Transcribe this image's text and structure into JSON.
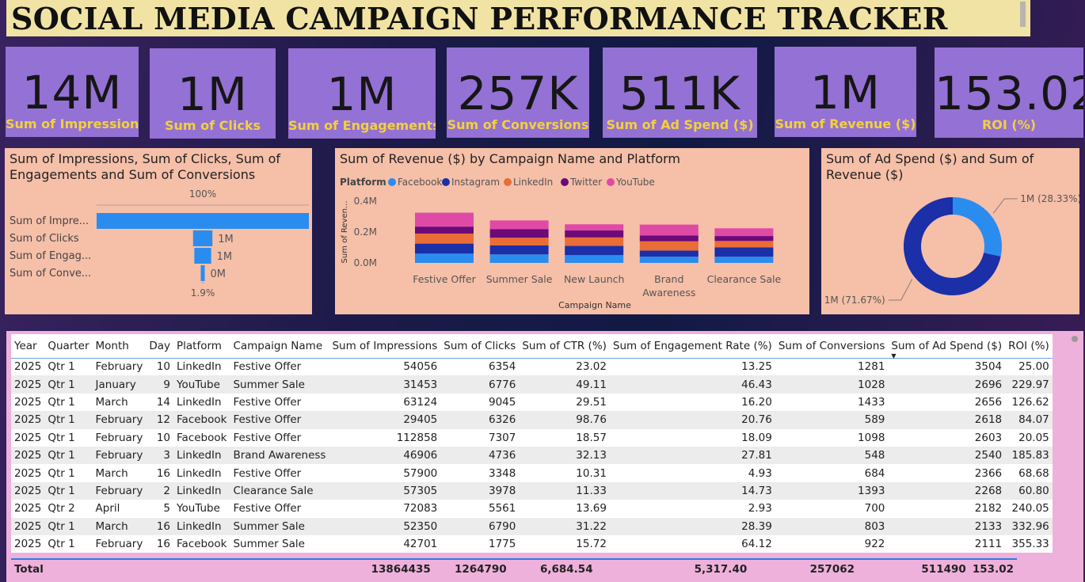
{
  "header": {
    "title": "SOCIAL MEDIA CAMPAIGN PERFORMANCE TRACKER"
  },
  "kpis": [
    {
      "value": "14M",
      "label": "Sum of Impressions"
    },
    {
      "value": "1M",
      "label": "Sum of Clicks"
    },
    {
      "value": "1M",
      "label": "Sum of Engagements"
    },
    {
      "value": "257K",
      "label": "Sum of Conversions"
    },
    {
      "value": "511K",
      "label": "Sum of Ad Spend ($)"
    },
    {
      "value": "1M",
      "label": "Sum of Revenue ($)"
    },
    {
      "value": "153.02",
      "label": "ROI (%)"
    }
  ],
  "colors": {
    "facebook": "#2b8cf0",
    "instagram": "#1a2fa8",
    "linkedin": "#ea6c37",
    "twitter": "#6b0a78",
    "youtube": "#df4aa6",
    "kpi_bg": "#9471d4",
    "kpi_label": "#f3d13a",
    "panel_bg": "#f6bfa8",
    "table_bg": "#eeb1db"
  },
  "funnel": {
    "title": "Sum of Impressions, Sum of Clicks, Sum of Engagements and Sum of Conversions",
    "top_label": "100%",
    "bottom_label": "1.9%",
    "items": [
      {
        "label": "Sum of Impre...",
        "value": 13864435,
        "value_label": ""
      },
      {
        "label": "Sum of Clicks",
        "value": 1264790,
        "value_label": "1M"
      },
      {
        "label": "Sum of Engag...",
        "value": 1100000,
        "value_label": "1M"
      },
      {
        "label": "Sum of Conve...",
        "value": 257062,
        "value_label": "0M"
      }
    ]
  },
  "revenue_chart": {
    "title": "Sum of Revenue ($) by Campaign Name and Platform",
    "legend_title": "Platform",
    "xlabel": "Campaign Name",
    "ylabel": "Sum of Reven...",
    "ticks": [
      "0.0M",
      "0.2M",
      "0.4M"
    ],
    "category_lines": [
      [
        "Festive Offer"
      ],
      [
        "Summer Sale"
      ],
      [
        "New Launch"
      ],
      [
        "Brand",
        "Awareness"
      ],
      [
        "Clearance Sale"
      ]
    ]
  },
  "donut": {
    "title": "Sum of Ad Spend ($) and Sum of Revenue ($)",
    "slices": [
      {
        "name": "Sum of Ad Spend ($)",
        "value": 28.33,
        "label": "1M (28.33%)",
        "color": "#2b8cf0"
      },
      {
        "name": "Sum of Revenue ($)",
        "value": 71.67,
        "label": "1M (71.67%)",
        "color": "#1a2fa8"
      }
    ]
  },
  "chart_data": [
    {
      "type": "bar",
      "stacked": true,
      "title": "Sum of Revenue ($) by Campaign Name and Platform",
      "xlabel": "Campaign Name",
      "ylabel": "Sum of Reven...",
      "categories": [
        "Festive Offer",
        "Summer Sale",
        "New Launch",
        "Brand Awareness",
        "Clearance Sale"
      ],
      "ylim": [
        0,
        0.4
      ],
      "y_unit": "M",
      "series": [
        {
          "name": "Facebook",
          "color": "#2b8cf0",
          "values": [
            0.06,
            0.055,
            0.05,
            0.04,
            0.04
          ]
        },
        {
          "name": "Instagram",
          "color": "#1a2fa8",
          "values": [
            0.065,
            0.058,
            0.06,
            0.04,
            0.06
          ]
        },
        {
          "name": "LinkedIn",
          "color": "#ea6c37",
          "values": [
            0.065,
            0.05,
            0.055,
            0.06,
            0.042
          ]
        },
        {
          "name": "Twitter",
          "color": "#6b0a78",
          "values": [
            0.045,
            0.055,
            0.045,
            0.038,
            0.032
          ]
        },
        {
          "name": "YouTube",
          "color": "#df4aa6",
          "values": [
            0.09,
            0.057,
            0.04,
            0.07,
            0.05
          ]
        }
      ],
      "legend": "top"
    },
    {
      "type": "pie",
      "title": "Sum of Ad Spend ($) and Sum of Revenue ($)",
      "categories": [
        "Sum of Ad Spend ($)",
        "Sum of Revenue ($)"
      ],
      "values": [
        28.33,
        71.67
      ]
    },
    {
      "type": "bar",
      "orientation": "horizontal-funnel",
      "title": "Sum of Impressions, Sum of Clicks, Sum of Engagements and Sum of Conversions",
      "categories": [
        "Sum of Impre...",
        "Sum of Clicks",
        "Sum of Engag...",
        "Sum of Conve..."
      ],
      "values": [
        13864435,
        1264790,
        1100000,
        257062
      ]
    }
  ],
  "table": {
    "columns": [
      "Year",
      "Quarter",
      "Month",
      "Day",
      "Platform",
      "Campaign Name",
      "Sum of Impressions",
      "Sum of Clicks",
      "Sum of CTR (%)",
      "Sum of Engagement Rate (%)",
      "Sum of Conversions",
      "Sum of Ad Spend ($)",
      "ROI (%)"
    ],
    "rows": [
      [
        "2025",
        "Qtr 1",
        "February",
        "10",
        "LinkedIn",
        "Festive Offer",
        "54056",
        "6354",
        "23.02",
        "13.25",
        "1281",
        "3504",
        "25.00"
      ],
      [
        "2025",
        "Qtr 1",
        "January",
        "9",
        "YouTube",
        "Summer Sale",
        "31453",
        "6776",
        "49.11",
        "46.43",
        "1028",
        "2696",
        "229.97"
      ],
      [
        "2025",
        "Qtr 1",
        "March",
        "14",
        "LinkedIn",
        "Festive Offer",
        "63124",
        "9045",
        "29.51",
        "16.20",
        "1433",
        "2656",
        "126.62"
      ],
      [
        "2025",
        "Qtr 1",
        "February",
        "12",
        "Facebook",
        "Festive Offer",
        "29405",
        "6326",
        "98.76",
        "20.76",
        "589",
        "2618",
        "84.07"
      ],
      [
        "2025",
        "Qtr 1",
        "February",
        "10",
        "Facebook",
        "Festive Offer",
        "112858",
        "7307",
        "18.57",
        "18.09",
        "1098",
        "2603",
        "20.05"
      ],
      [
        "2025",
        "Qtr 1",
        "February",
        "3",
        "LinkedIn",
        "Brand Awareness",
        "46906",
        "4736",
        "32.13",
        "27.81",
        "548",
        "2540",
        "185.83"
      ],
      [
        "2025",
        "Qtr 1",
        "March",
        "16",
        "LinkedIn",
        "Festive Offer",
        "57900",
        "3348",
        "10.31",
        "4.93",
        "684",
        "2366",
        "68.68"
      ],
      [
        "2025",
        "Qtr 1",
        "February",
        "2",
        "LinkedIn",
        "Clearance Sale",
        "57305",
        "3978",
        "11.33",
        "14.73",
        "1393",
        "2268",
        "60.80"
      ],
      [
        "2025",
        "Qtr 2",
        "April",
        "5",
        "YouTube",
        "Festive Offer",
        "72083",
        "5561",
        "13.69",
        "2.93",
        "700",
        "2182",
        "240.05"
      ],
      [
        "2025",
        "Qtr 1",
        "March",
        "16",
        "LinkedIn",
        "Summer Sale",
        "52350",
        "6790",
        "31.22",
        "28.39",
        "803",
        "2133",
        "332.96"
      ],
      [
        "2025",
        "Qtr 1",
        "February",
        "16",
        "Facebook",
        "Summer Sale",
        "42701",
        "1775",
        "15.72",
        "64.12",
        "922",
        "2111",
        "355.33"
      ]
    ],
    "total": {
      "label": "Total",
      "impressions": "13864435",
      "clicks": "1264790",
      "ctr": "6,684.54",
      "engagement_rate": "5,317.40",
      "conversions": "257062",
      "ad_spend": "511490",
      "roi": "153.02"
    },
    "sort_column": "Sum of Ad Spend ($)",
    "sort_indicator": "descending"
  }
}
